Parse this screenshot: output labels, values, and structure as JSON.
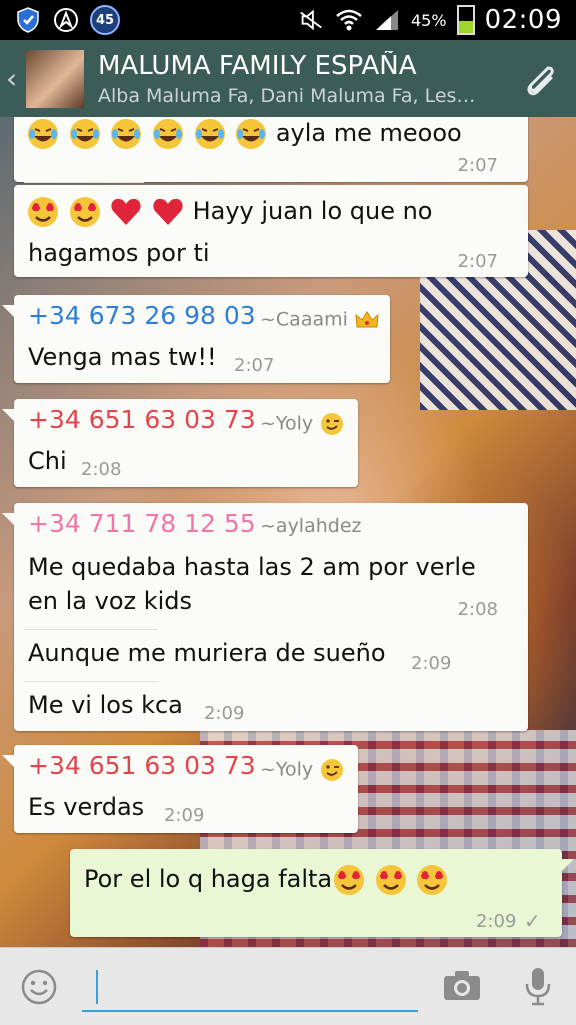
{
  "status_bar": {
    "notification_badge": "45",
    "battery_percent": "45%",
    "battery_level": 0.45,
    "time": "02:09",
    "icons": [
      "shield-icon",
      "navigation-icon",
      "mute-icon",
      "wifi-icon",
      "signal-icon",
      "battery-icon"
    ]
  },
  "header": {
    "back_icon": "‹",
    "title": "MALUMA FAMILY ESPAÑA",
    "subtitle": "Alba Maluma Fa, Dani Maluma Fa, Les…",
    "attach_icon": "paperclip-icon"
  },
  "colors": {
    "header_bg": "#3c5c58",
    "sender_blue": "#2f7fd6",
    "sender_red": "#e0464f",
    "sender_pink": "#ef77a8",
    "outgoing_bubble": "#eaf7d4"
  },
  "messages": {
    "m1": {
      "emojis": [
        "laughing-tears",
        "laughing-tears",
        "laughing-tears",
        "laughing-tears",
        "laughing-tears",
        "laughing-tears"
      ],
      "text": "ayla me meooo",
      "time": "2:07"
    },
    "m2": {
      "emojis": [
        "heart-eyes",
        "heart-eyes",
        "red-heart",
        "red-heart"
      ],
      "text_line1": "Hayy juan lo que no",
      "text_line2": "hagamos por ti",
      "time": "2:07"
    },
    "m3": {
      "sender": "+34 673 26 98 03",
      "nick": "~Caaami",
      "nick_emoji": "crown",
      "text": "Venga mas tw!!",
      "time": "2:07"
    },
    "m4": {
      "sender": "+34 651 63 03 73",
      "nick": "~Yoly",
      "nick_emoji": "wink",
      "text": "Chi",
      "time": "2:08"
    },
    "m5": {
      "sender": "+34 711 78 12 55",
      "nick": "~aylahdez",
      "text_line1": "Me quedaba hasta las 2 am por verle",
      "text_line2": "en la voz kids",
      "time": "2:08"
    },
    "m6": {
      "text": "Aunque me muriera de sueño",
      "time": "2:09"
    },
    "m7": {
      "text": "Me vi los kca",
      "time": "2:09"
    },
    "m8": {
      "sender": "+34 651 63 03 73",
      "nick": "~Yoly",
      "nick_emoji": "wink",
      "text": "Es verdas",
      "time": "2:09"
    },
    "m9": {
      "text": "Por el lo q haga falta",
      "emojis": [
        "heart-eyes",
        "heart-eyes",
        "heart-eyes"
      ],
      "time": "2:09",
      "status_icon": "check-icon",
      "status": "✓"
    }
  },
  "input_bar": {
    "emoji_icon": "smiley-icon",
    "camera_icon": "camera-icon",
    "mic_icon": "microphone-icon",
    "message_value": ""
  }
}
